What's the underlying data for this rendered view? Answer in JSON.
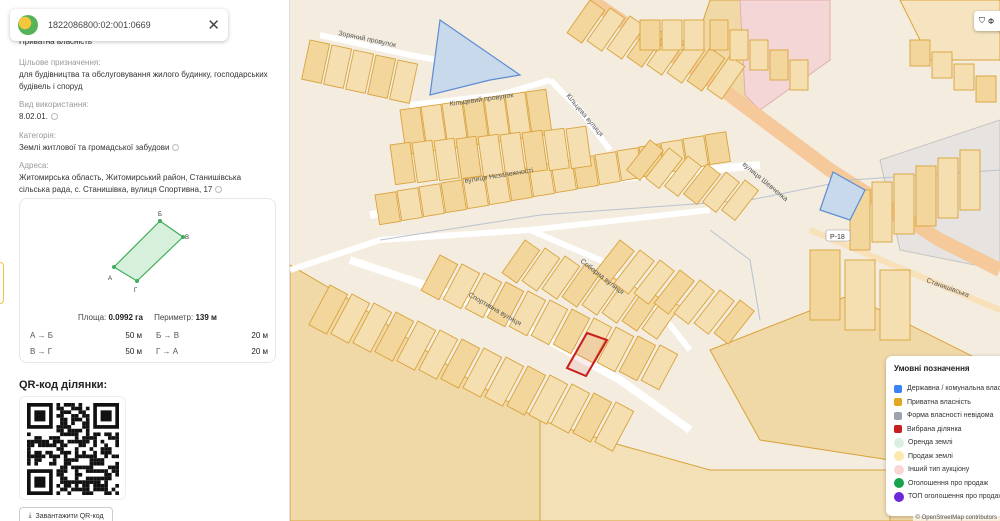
{
  "search": {
    "cadastral_number": "1822086800:02:001:0669"
  },
  "parcel": {
    "ownership": "Приватна власність",
    "purpose_label": "Цільове призначення:",
    "purpose_value": "для будівництва та обслуговування жилого будинку, господарських будівель і споруд",
    "usage_label": "Вид використання:",
    "usage_value": "8.02.01.",
    "category_label": "Категорія:",
    "category_value": "Землі житлової та громадської забудови",
    "address_label": "Адреса:",
    "address_value": "Житомирська область, Житомирський район, Станишівська сільська рада, с. Станишівка, вулиця Спортивна, 17"
  },
  "shape": {
    "vertices": {
      "a": "А",
      "b": "Б",
      "v": "В",
      "g": "Г"
    },
    "area_label": "Площа:",
    "area_value": "0.0992 га",
    "perimeter_label": "Периметр:",
    "perimeter_value": "139 м",
    "sides": [
      {
        "name": "А → Б",
        "length": "50 м"
      },
      {
        "name": "Б → В",
        "length": "20 м"
      },
      {
        "name": "В → Г",
        "length": "50 м"
      },
      {
        "name": "Г → А",
        "length": "20 м"
      }
    ]
  },
  "qr": {
    "title": "QR-код ділянки:",
    "download_label": "Завантажити QR-код"
  },
  "map": {
    "filter_label": "Ф",
    "street_labels": {
      "zorianyi": "Зоряний провулок",
      "kiltsevyi_pr": "Кільцевий провулок",
      "kiltseva": "Кільцева вулиця",
      "nezalezhnosti": "вулиця Незалежності",
      "shevchenka": "вулиця Шевченка",
      "sobornа": "Соборна вулиця",
      "sportyvna": "Спортивна вулиця",
      "stanyshivska": "Станишівська",
      "road": "Р-18"
    },
    "attribution": "© OpenStreetMap contributors"
  },
  "legend": {
    "title": "Умовні позначення",
    "items": [
      {
        "label": "Державна / комунальна власність",
        "color": "#3b82f6",
        "kind": "square"
      },
      {
        "label": "Приватна власність",
        "color": "#e2a623",
        "kind": "square"
      },
      {
        "label": "Форма власності невідома",
        "color": "#9ca3af",
        "kind": "square"
      },
      {
        "label": "Вибрана ділянка",
        "color": "#c81e1e",
        "kind": "square"
      },
      {
        "label": "Оренда землі",
        "color": "#d9efe3",
        "kind": "dot"
      },
      {
        "label": "Продаж землі",
        "color": "#fde8b0",
        "kind": "dot"
      },
      {
        "label": "Інший тип аукціону",
        "color": "#f8d7d3",
        "kind": "dot"
      },
      {
        "label": "Оголошення про продаж",
        "color": "#16a34a",
        "kind": "dot"
      },
      {
        "label": "ТОП оголошення про продаж",
        "color": "#6d28d9",
        "kind": "dot"
      }
    ]
  }
}
